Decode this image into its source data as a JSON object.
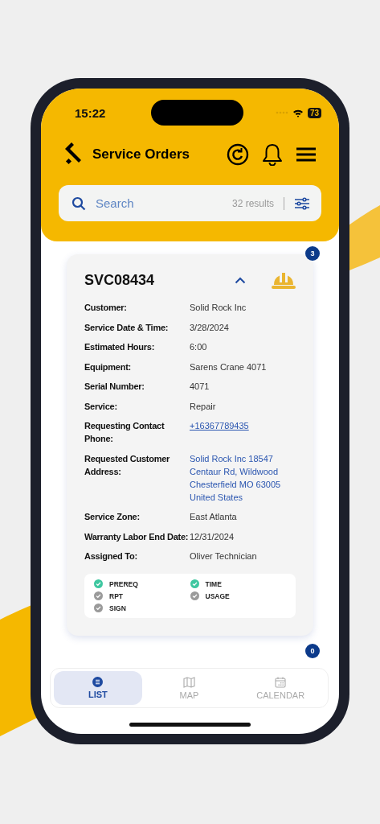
{
  "status_bar": {
    "time": "15:22",
    "battery": "73"
  },
  "header": {
    "title": "Service Orders"
  },
  "search": {
    "placeholder": "Search",
    "results": "32 results"
  },
  "orders": [
    {
      "id": "SVC08434",
      "badge": "3",
      "expanded": true,
      "fields": [
        {
          "label": "Customer:",
          "value": "Solid Rock Inc",
          "kind": "text"
        },
        {
          "label": "Service Date & Time:",
          "value": "3/28/2024",
          "kind": "text"
        },
        {
          "label": "Estimated Hours:",
          "value": "6:00",
          "kind": "text"
        },
        {
          "label": "Equipment:",
          "value": "Sarens Crane 4071",
          "kind": "text"
        },
        {
          "label": "Serial Number:",
          "value": "4071",
          "kind": "text"
        },
        {
          "label": "Service:",
          "value": "Repair",
          "kind": "text"
        },
        {
          "label": "Requesting Contact Phone:",
          "value": "+16367789435",
          "kind": "phone"
        },
        {
          "label": "Requested Customer Address:",
          "value": "Solid Rock Inc 18547 Centaur Rd, Wildwood Chesterfield MO 63005 United States",
          "kind": "address"
        },
        {
          "label": "Service Zone:",
          "value": "East Atlanta",
          "kind": "text"
        },
        {
          "label": "Warranty Labor End Date:",
          "value": "12/31/2024",
          "kind": "text"
        },
        {
          "label": "Assigned To:",
          "value": "Oliver Technician",
          "kind": "text"
        }
      ],
      "checks": [
        {
          "label": "PREREQ",
          "done": true
        },
        {
          "label": "TIME",
          "done": true
        },
        {
          "label": "RPT",
          "done": false
        },
        {
          "label": "USAGE",
          "done": false
        },
        {
          "label": "SIGN",
          "done": false
        }
      ]
    },
    {
      "badge": "0"
    }
  ],
  "nav": [
    {
      "label": "LIST",
      "kind": "list",
      "selected": true
    },
    {
      "label": "MAP",
      "kind": "map",
      "selected": false
    },
    {
      "label": "CALENDAR",
      "kind": "calendar",
      "selected": false
    }
  ]
}
